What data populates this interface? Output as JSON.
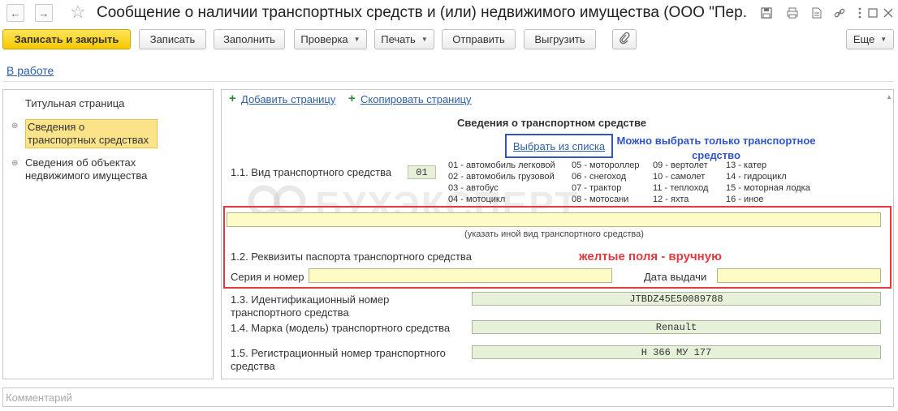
{
  "window": {
    "title": "Сообщение о наличии транспортных средств и (или) недвижимого имущества (ООО \"Пер...",
    "back_icon": "arrow-left-icon",
    "forward_icon": "arrow-right-icon",
    "favorite_icon": "star-icon",
    "actions": [
      "save-icon",
      "print-icon",
      "document-icon",
      "link-icon",
      "more-icon",
      "maximize-icon",
      "close-icon"
    ]
  },
  "toolbar": {
    "save_close_label": "Записать и закрыть",
    "save_label": "Записать",
    "fill_label": "Заполнить",
    "check_label": "Проверка",
    "print_label": "Печать",
    "send_label": "Отправить",
    "export_label": "Выгрузить",
    "more_label": "Еще"
  },
  "status": {
    "label": "В работе"
  },
  "sidebar": {
    "items": [
      {
        "label": "Титульная страница"
      },
      {
        "label": "Сведения о транспортных средствах",
        "selected": true
      },
      {
        "label": "Сведения об объектах недвижимого имущества"
      }
    ]
  },
  "form": {
    "add_page": "Добавить страницу",
    "copy_page": "Скопировать страницу",
    "section_title": "Сведения о транспортном средстве",
    "pick_from_list": "Выбрать из списка",
    "note_blue": "Можно выбрать только транспортное средство",
    "vehicle_type_label": "1.1. Вид транспортного средства",
    "vehicle_type_code": "01",
    "codes": {
      "col1": [
        "01 - автомобиль легковой",
        "02 - автомобиль грузовой",
        "03 - автобус",
        "04 - мотоцикл"
      ],
      "col2": [
        "05 - мотороллер",
        "06 - снегоход",
        "07 - трактор",
        "08 - мотосани"
      ],
      "col3": [
        "09 - вертолет",
        "10 - самолет",
        "11 - теплоход",
        "12 - яхта"
      ],
      "col4": [
        "13 - катер",
        "14 - гидроцикл",
        "15 - моторная лодка",
        "16 - иное"
      ]
    },
    "other_type_value": "",
    "other_type_hint": "(указать иной вид транспортного средства)",
    "passport_label": "1.2. Реквизиты паспорта транспортного средства",
    "note_red": "желтые поля - вручную",
    "series_label": "Серия и номер",
    "series_value": "",
    "issue_date_label": "Дата выдачи",
    "issue_date_value": "",
    "vin_label": "1.3. Идентификационный номер транспортного средства",
    "vin_value": "JTBDZ45E50089788",
    "brand_label": "1.4. Марка (модель) транспортного средства",
    "brand_value": "Renault",
    "reg_label": "1.5. Регистрационный номер транспортного средства",
    "reg_value": "Н 366 МУ 177"
  },
  "watermark": {
    "text": "БУХЭКСПЕРТ"
  },
  "comment": {
    "placeholder": "Комментарий"
  }
}
